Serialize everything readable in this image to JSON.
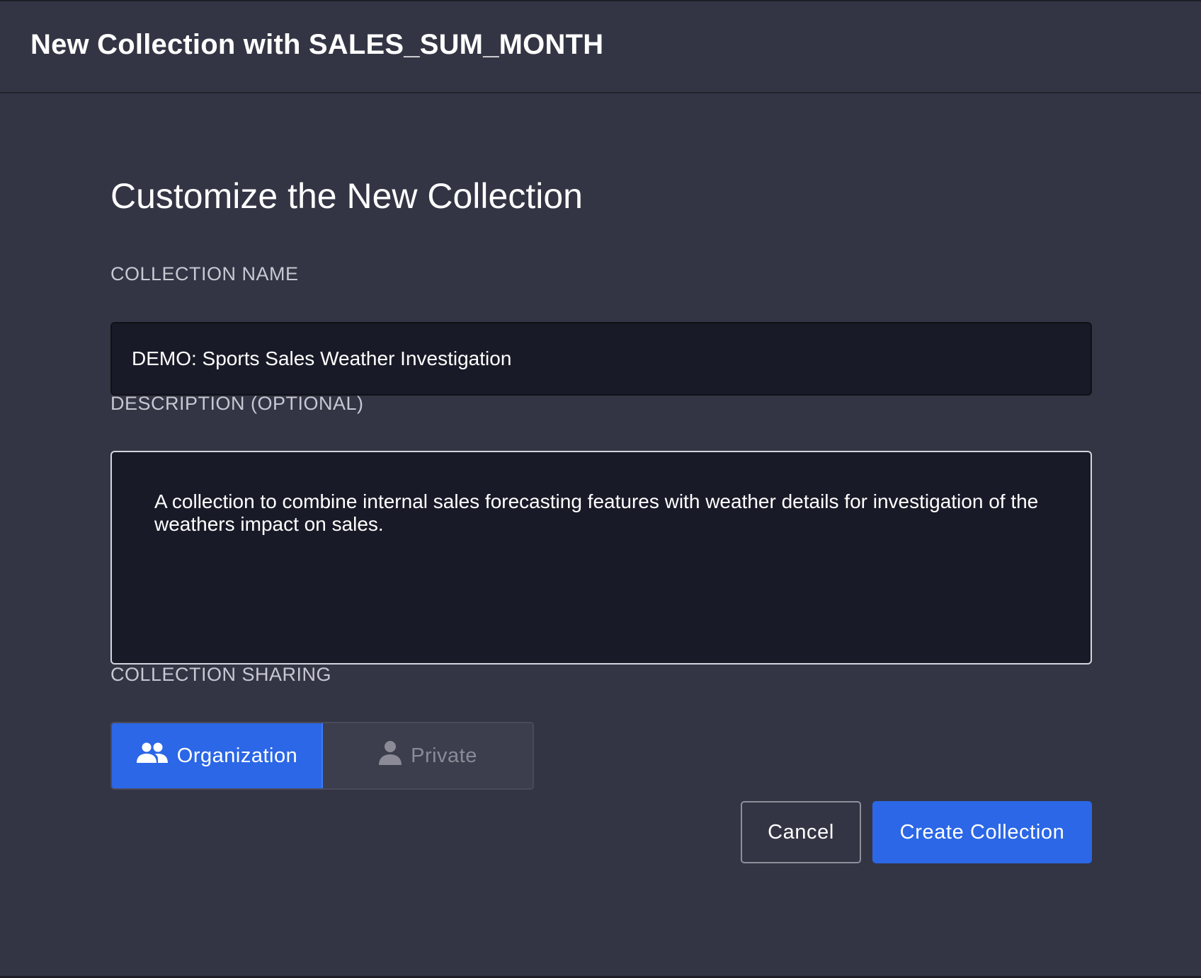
{
  "dialog": {
    "title": "New Collection with SALES_SUM_MONTH"
  },
  "form": {
    "heading": "Customize the New Collection",
    "name_label": "COLLECTION NAME",
    "name_value": "DEMO: Sports Sales Weather Investigation",
    "description_label": "DESCRIPTION (OPTIONAL)",
    "description_value": "A collection to combine internal sales forecasting features with weather details for investigation of the weathers impact on sales.",
    "sharing_label": "COLLECTION SHARING",
    "sharing_options": [
      {
        "label": "Organization",
        "icon": "group-icon",
        "selected": true
      },
      {
        "label": "Private",
        "icon": "person-icon",
        "selected": false
      }
    ]
  },
  "actions": {
    "cancel_label": "Cancel",
    "create_label": "Create Collection"
  },
  "colors": {
    "background": "#343544",
    "accent": "#2b67e6",
    "input_background": "#191a27"
  }
}
